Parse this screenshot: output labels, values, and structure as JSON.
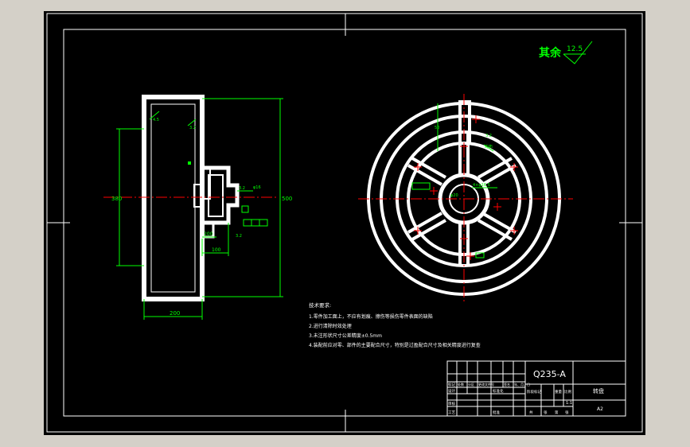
{
  "drawing": {
    "surface_roughness": {
      "label": "其余",
      "value": "12.5"
    },
    "tech_requirements": {
      "title": "技术要求:",
      "items": [
        "1.零件加工面上，不应有划痕、擦伤等损伤零件表面的缺陷",
        "2.进行清除时效处理",
        "3.未注形状尺寸公差精度±0.5mm",
        "4.装配前应对零、部件的主要配合尺寸，特别是过盈配合尺寸及相关精度进行复查"
      ]
    },
    "side_view": {
      "width_dim": "200",
      "hub_dim": "100",
      "hub_dim2": "200"
    },
    "front_view": {
      "annotation": "均布"
    }
  },
  "title_block": {
    "material": "Q235-A",
    "part_name": "转盘",
    "scale": "1:1",
    "sheet": "A2",
    "row_labels": [
      "标记",
      "设计",
      "审核",
      "工艺"
    ],
    "header_cells": [
      "处数",
      "分区",
      "更改文件号",
      "签名",
      "年、月、日"
    ],
    "std_label": "标准化",
    "approve_label": "批准",
    "stage_labels": [
      "阶段标记",
      "重量",
      "比例"
    ],
    "sheet_labels": [
      "共",
      "张",
      "第",
      "张"
    ]
  },
  "colors": {
    "background": "#000000",
    "lines": "#ffffff",
    "dimensions": "#00ff00",
    "centerlines": "#ff0000",
    "ui_frame": "#d4d0c8"
  }
}
